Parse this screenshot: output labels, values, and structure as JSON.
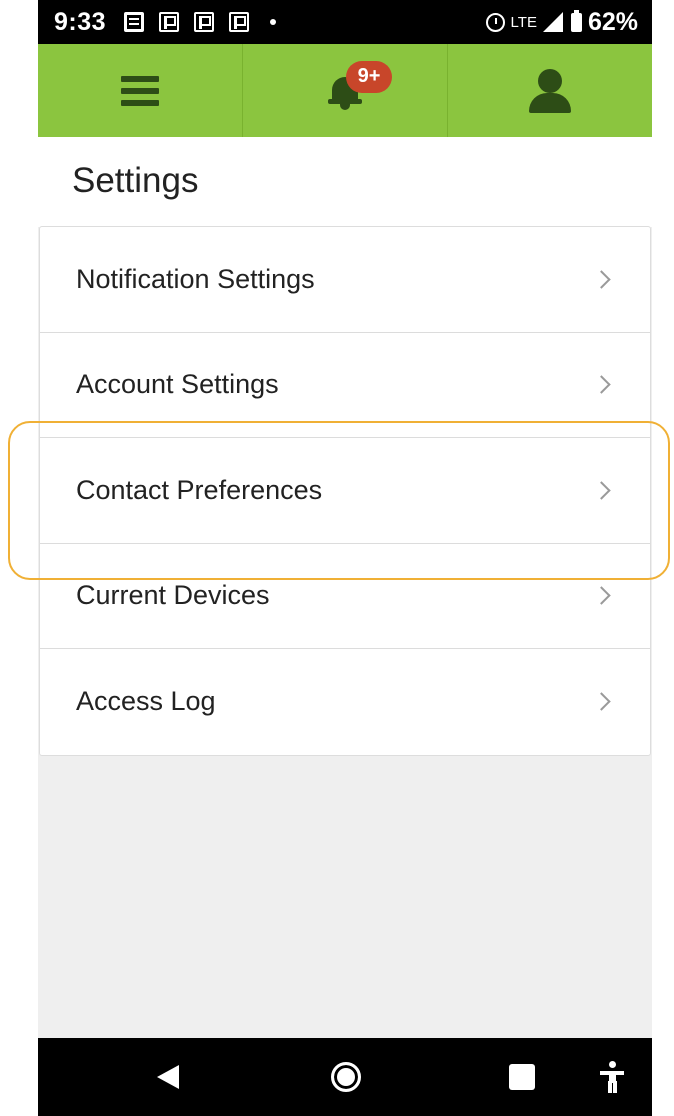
{
  "status_bar": {
    "time": "9:33",
    "network": "LTE",
    "battery": "62%",
    "notification_icons": [
      "message-icon",
      "flag-icon",
      "flag-icon",
      "flag-icon"
    ]
  },
  "app_bar": {
    "notification_badge": "9+",
    "accent_color": "#8bc53f"
  },
  "page": {
    "title": "Settings"
  },
  "settings": {
    "items": [
      {
        "label": "Notification Settings"
      },
      {
        "label": "Account Settings"
      },
      {
        "label": "Contact Preferences"
      },
      {
        "label": "Current Devices"
      },
      {
        "label": "Access Log"
      }
    ]
  },
  "highlight": {
    "target": "Contact Preferences",
    "color": "#f0b035"
  }
}
